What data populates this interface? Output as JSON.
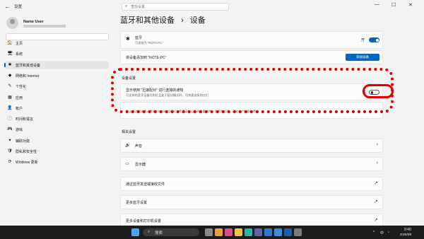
{
  "window": {
    "title": "设置",
    "back_icon": "←",
    "minimize": "—",
    "maximize": "☐",
    "close": "✕"
  },
  "search": {
    "placeholder": "查找设置"
  },
  "user": {
    "name": "Name User"
  },
  "nav": [
    {
      "icon": "🏠",
      "label": "主页",
      "selected": false
    },
    {
      "icon": "🖥",
      "label": "系统",
      "selected": false
    },
    {
      "icon": "✱",
      "label": "蓝牙和其他设备",
      "selected": true
    },
    {
      "icon": "◆",
      "label": "网络和 Internet",
      "selected": false
    },
    {
      "icon": "✎",
      "label": "个性化",
      "selected": false
    },
    {
      "icon": "▦",
      "label": "应用",
      "selected": false
    },
    {
      "icon": "👤",
      "label": "帐户",
      "selected": false
    },
    {
      "icon": "🕒",
      "label": "时间和语言",
      "selected": false
    },
    {
      "icon": "🎮",
      "label": "游戏",
      "selected": false
    },
    {
      "icon": "✦",
      "label": "辅助功能",
      "selected": false
    },
    {
      "icon": "🛡",
      "label": "隐私和安全性",
      "selected": false
    },
    {
      "icon": "⟳",
      "label": "Windows 更新",
      "selected": false
    }
  ],
  "page": {
    "breadcrumb_parent": "蓝牙和其他设备",
    "breadcrumb_sep": "›",
    "breadcrumb_current": "设备"
  },
  "bluetooth": {
    "title": "蓝牙",
    "subtitle": "可发现为 \"NOTE-PC\"",
    "state": "开",
    "on": true
  },
  "add_device": {
    "label": "将设备添加到 \"NOTE-PC\"",
    "button": "添加设备"
  },
  "device_settings": {
    "header": "设备设置",
    "swift_pair_title": "显示使用 \"迅速配对\" 进行连接的通知",
    "swift_pair_subtitle": "可支持的蓝牙设备在附近且处于配对模式时，可快速连接到它们",
    "swift_pair_state": "关",
    "metered_note": "防止通过按流量计费的 Internet 连接时，将下载新设备的设备软件、信息和应用，可能会产生额外费用"
  },
  "related": {
    "header": "相关设置",
    "items": [
      {
        "icon": "🔊",
        "label": "声音",
        "arrow": "›"
      },
      {
        "icon": "▭",
        "label": "显示器",
        "arrow": "›"
      },
      {
        "icon": "",
        "label": "通过蓝牙发送或接收文件",
        "arrow": "↗"
      },
      {
        "icon": "",
        "label": "更多蓝牙设置",
        "arrow": "↗"
      },
      {
        "icon": "",
        "label": "更多设备和打印机设置",
        "arrow": "↗"
      }
    ]
  },
  "taskbar": {
    "search_placeholder": "搜索",
    "time": "9:40",
    "date": "2025/8/6",
    "tray_chevron": "^",
    "ime": "中",
    "apps": [
      {
        "name": "windows-start-icon",
        "color": "#4aa3ff"
      },
      {
        "name": "task-view-icon",
        "color": "#8a8a8a"
      },
      {
        "name": "copilot-icon",
        "color": "#e8a23c"
      },
      {
        "name": "widgets-icon",
        "color": "#d94f8a"
      },
      {
        "name": "file-explorer-icon",
        "color": "#f2c14e"
      },
      {
        "name": "edge-icon",
        "color": "#2fb3a3"
      },
      {
        "name": "teams-icon",
        "color": "#6264a7"
      },
      {
        "name": "store-icon",
        "color": "#2b7bd1"
      },
      {
        "name": "photos-icon",
        "color": "#3b8fd6"
      },
      {
        "name": "security-icon",
        "color": "#1f5fa8"
      },
      {
        "name": "settings-app-icon",
        "color": "#7a7a7a"
      }
    ]
  }
}
